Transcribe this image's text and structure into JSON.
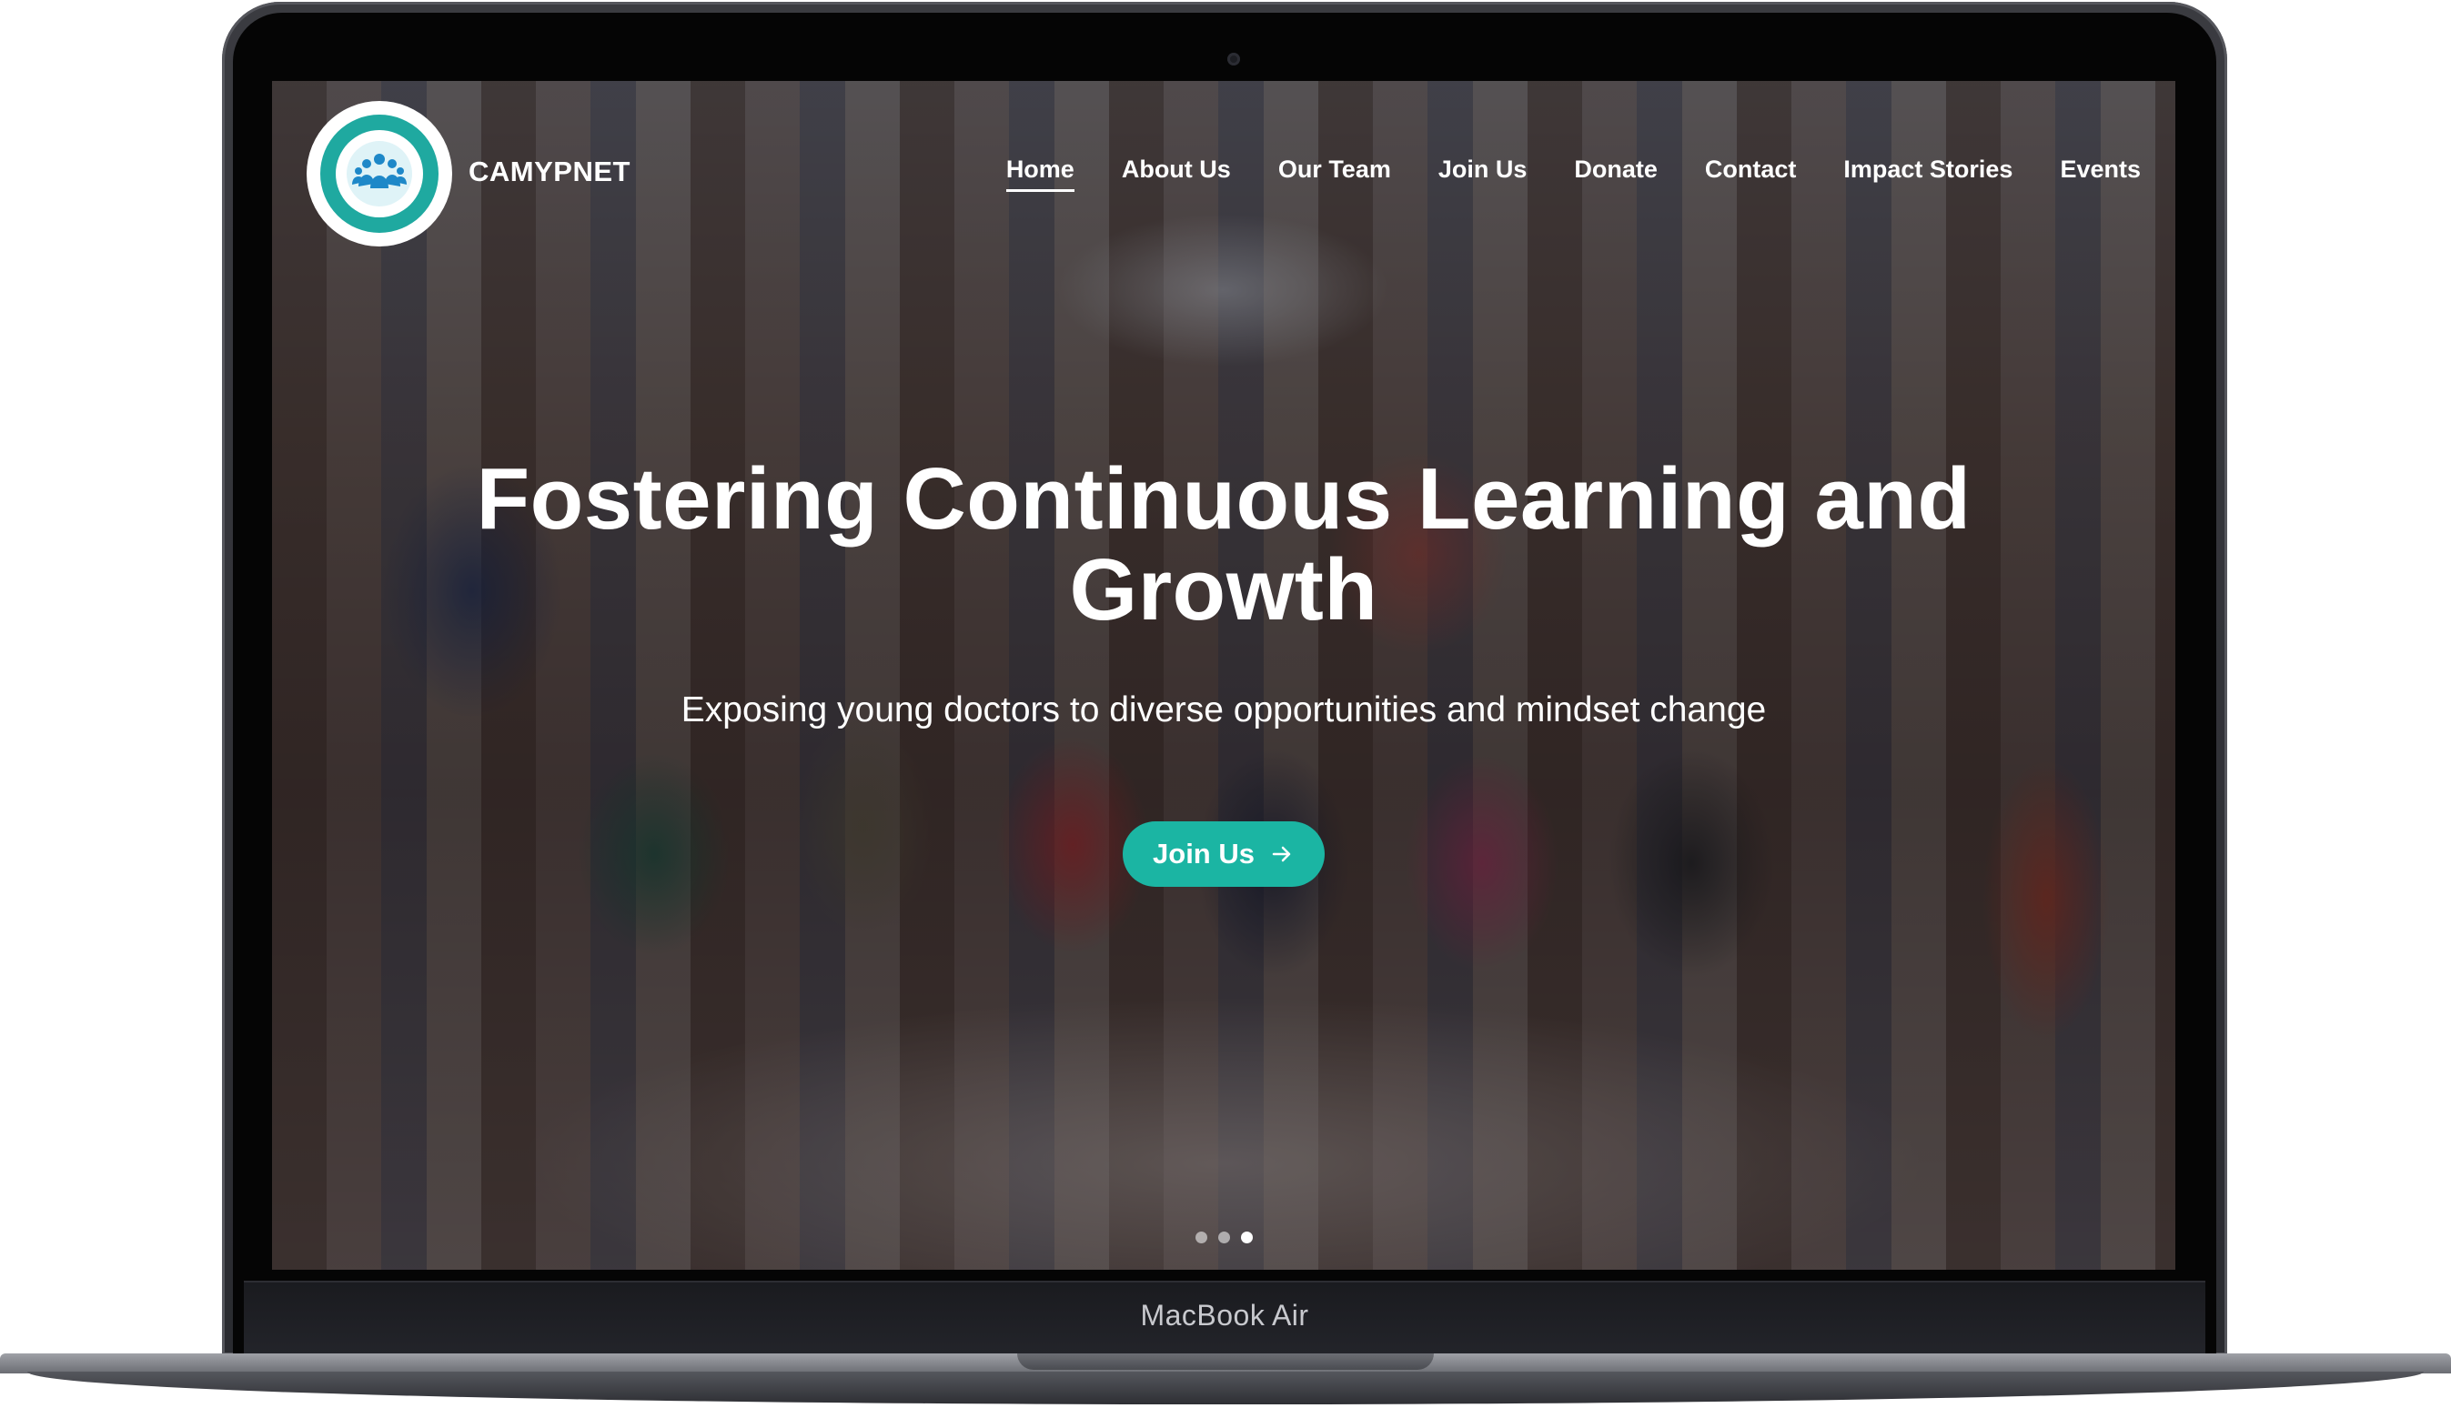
{
  "device": {
    "model_label": "MacBook Air"
  },
  "brand": {
    "name": "CAMYPNET",
    "logo_color": "#1fa9a0"
  },
  "nav": {
    "items": [
      {
        "label": "Home",
        "active": true
      },
      {
        "label": "About Us",
        "active": false
      },
      {
        "label": "Our Team",
        "active": false
      },
      {
        "label": "Join Us",
        "active": false
      },
      {
        "label": "Donate",
        "active": false
      },
      {
        "label": "Contact",
        "active": false
      },
      {
        "label": "Impact Stories",
        "active": false
      },
      {
        "label": "Events",
        "active": false
      }
    ]
  },
  "hero": {
    "title": "Fostering Continuous Learning and Growth",
    "subtitle": "Exposing young doctors to diverse opportunities and mindset change",
    "cta_label": "Join Us",
    "cta_icon": "arrow-right-icon",
    "cta_color": "#1bb5a3"
  },
  "carousel": {
    "slide_count": 3,
    "active_slide": 3
  }
}
